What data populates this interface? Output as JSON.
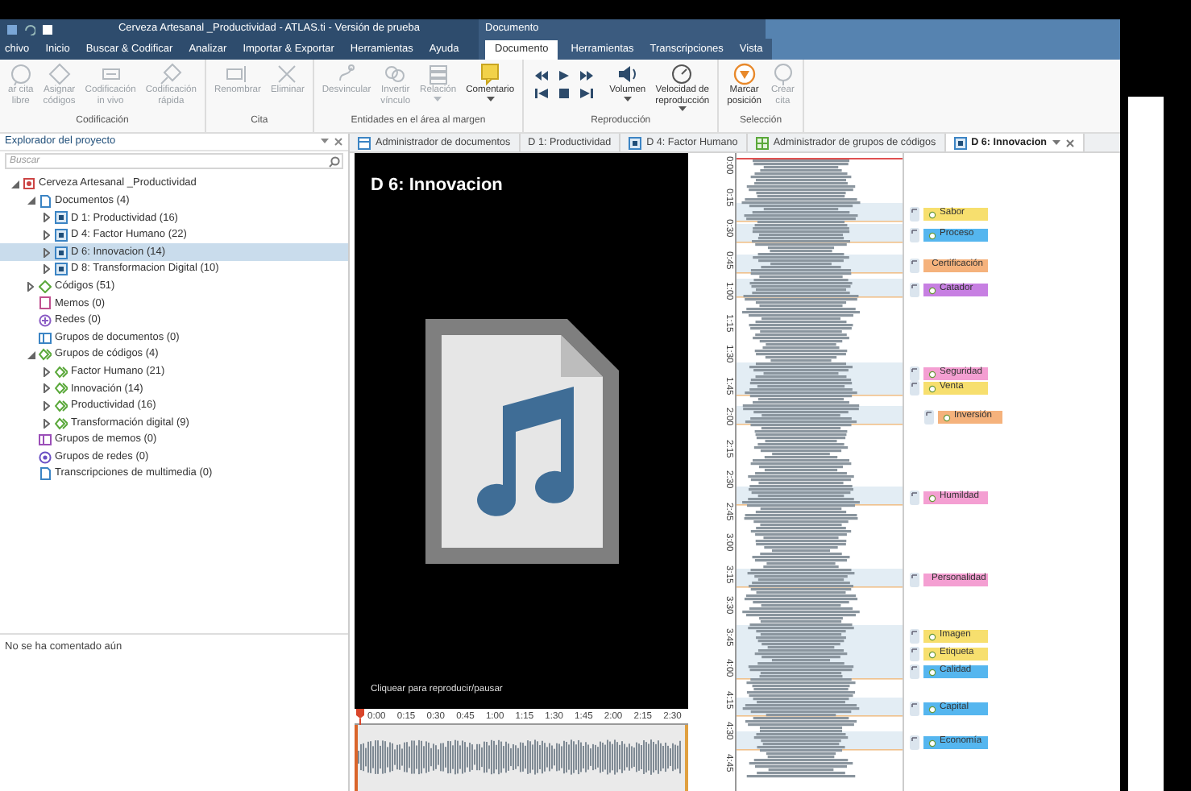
{
  "title_bar": {
    "title": "Cerveza Artesanal _Productividad - ATLAS.ti - Versión de prueba",
    "context_title": "Documento"
  },
  "menu_bar": {
    "tabs": [
      {
        "label": "chivo",
        "selected": false
      },
      {
        "label": "Inicio",
        "selected": false
      },
      {
        "label": "Buscar & Codificar",
        "selected": false
      },
      {
        "label": "Analizar",
        "selected": false
      },
      {
        "label": "Importar & Exportar",
        "selected": false
      },
      {
        "label": "Herramientas",
        "selected": false
      },
      {
        "label": "Ayuda",
        "selected": false
      }
    ],
    "context_tabs": [
      {
        "label": "Documento",
        "selected": true
      },
      {
        "label": "Herramientas",
        "selected": false
      },
      {
        "label": "Transcripciones",
        "selected": false
      },
      {
        "label": "Vista",
        "selected": false
      }
    ]
  },
  "ribbon": [
    {
      "title": "Codificación",
      "buttons": [
        {
          "kind": "large",
          "label": "ar cita\nlibre",
          "disabled": true,
          "dropdown": false
        },
        {
          "kind": "large",
          "label": "Asignar\ncódigos",
          "disabled": true,
          "dropdown": false
        },
        {
          "kind": "large",
          "label": "Codificación\nin vivo",
          "disabled": true,
          "dropdown": false
        },
        {
          "kind": "large",
          "label": "Codificación\nrápida",
          "disabled": true,
          "dropdown": false
        }
      ]
    },
    {
      "title": "Cita",
      "buttons": [
        {
          "kind": "large",
          "label": "Renombrar",
          "disabled": true,
          "dropdown": false
        },
        {
          "kind": "large",
          "label": "Eliminar",
          "disabled": true,
          "dropdown": false
        }
      ]
    },
    {
      "title": "Entidades en el área al margen",
      "buttons": [
        {
          "kind": "large",
          "label": "Desvincular",
          "disabled": true,
          "dropdown": false
        },
        {
          "kind": "large",
          "label": "Invertir\nvínculo",
          "disabled": true,
          "dropdown": false
        },
        {
          "kind": "large",
          "label": "Relación",
          "disabled": true,
          "dropdown": true
        },
        {
          "kind": "large",
          "label": "Comentario",
          "disabled": false,
          "dropdown": true
        }
      ]
    },
    {
      "title": "Reproducción",
      "buttons": [
        {
          "kind": "transport"
        },
        {
          "kind": "large",
          "label": "Volumen",
          "disabled": false,
          "dropdown": true
        },
        {
          "kind": "large",
          "label": "Velocidad de\nreproducción",
          "disabled": false,
          "dropdown": true
        }
      ]
    },
    {
      "title": "Selección",
      "buttons": [
        {
          "kind": "large",
          "label": "Marcar\nposición",
          "disabled": false,
          "dropdown": false
        },
        {
          "kind": "large",
          "label": "Crear\ncita",
          "disabled": true,
          "dropdown": false
        }
      ]
    }
  ],
  "explorer": {
    "title": "Explorador del proyecto",
    "search": {
      "placeholder": "Buscar"
    },
    "tree": [
      {
        "label": "Cerveza Artesanal _Productividad",
        "kind": "project",
        "expanded": true,
        "selected": false,
        "children": [
          {
            "label": "Documentos (4)",
            "kind": "documents",
            "expanded": true,
            "selected": false,
            "children": [
              {
                "label": "D 1: Productividad (16)",
                "kind": "document",
                "expanded": false,
                "selected": false
              },
              {
                "label": "D 4: Factor Humano (22)",
                "kind": "document",
                "expanded": false,
                "selected": false
              },
              {
                "label": "D 6: Innovacion (14)",
                "kind": "document",
                "expanded": false,
                "selected": true
              },
              {
                "label": "D 8: Transformacion Digital (10)",
                "kind": "document",
                "expanded": false,
                "selected": false
              }
            ]
          },
          {
            "label": "Códigos (51)",
            "kind": "codes",
            "expanded": false,
            "selected": false
          },
          {
            "label": "Memos (0)",
            "kind": "memos",
            "selected": false
          },
          {
            "label": "Redes (0)",
            "kind": "networks",
            "selected": false
          },
          {
            "label": "Grupos de documentos (0)",
            "kind": "docgroups",
            "selected": false
          },
          {
            "label": "Grupos de códigos (4)",
            "kind": "codegroups",
            "expanded": true,
            "selected": false,
            "children": [
              {
                "label": "Factor Humano (21)",
                "kind": "codegroup",
                "expanded": false,
                "selected": false
              },
              {
                "label": "Innovación (14)",
                "kind": "codegroup",
                "expanded": false,
                "selected": false
              },
              {
                "label": "Productividad (16)",
                "kind": "codegroup",
                "expanded": false,
                "selected": false
              },
              {
                "label": "Transformación digital (9)",
                "kind": "codegroup",
                "expanded": false,
                "selected": false
              }
            ]
          },
          {
            "label": "Grupos de memos (0)",
            "kind": "memogroups",
            "selected": false
          },
          {
            "label": "Grupos de redes (0)",
            "kind": "netgroups",
            "selected": false
          },
          {
            "label": "Transcripciones de multimedia (0)",
            "kind": "transcripts",
            "selected": false
          }
        ]
      }
    ],
    "comment": "No se ha comentado aún"
  },
  "doc_tabs": [
    {
      "label": "Administrador de documentos",
      "kind": "manager",
      "selected": false
    },
    {
      "label": "D 1: Productividad",
      "kind": "plain",
      "selected": false
    },
    {
      "label": "D 4: Factor Humano",
      "kind": "document",
      "selected": false
    },
    {
      "label": "Administrador de grupos de códigos",
      "kind": "group-manager",
      "selected": false
    },
    {
      "label": "D 6: Innovacion",
      "kind": "document",
      "selected": true
    }
  ],
  "media": {
    "title": "D 6: Innovacion",
    "hint": "Cliquear para reproducir/pausar",
    "timeline": [
      "0:00",
      "0:15",
      "0:30",
      "0:45",
      "1:00",
      "1:15",
      "1:30",
      "1:45",
      "2:00",
      "2:15",
      "2:30"
    ],
    "ruler": [
      "0:00",
      "0:15",
      "0:30",
      "0:45",
      "1:00",
      "1:15",
      "1:30",
      "1:45",
      "2:00",
      "2:15",
      "2:30",
      "2:45",
      "3:00",
      "3:15",
      "3:30",
      "3:45",
      "4:00",
      "4:15",
      "4:30",
      "4:45"
    ]
  },
  "codes": [
    {
      "label": "Sabor",
      "color": "#f7df6e"
    },
    {
      "label": "Proceso",
      "color": "#55b6ef"
    },
    {
      "label": "Certificación",
      "color": "#f5b27c"
    },
    {
      "label": "Catador",
      "color": "#c77fe2"
    },
    {
      "label": "Seguridad",
      "color": "#f49fd2"
    },
    {
      "label": "Venta",
      "color": "#f7df6e"
    },
    {
      "label": "Inversión",
      "color": "#f5b27c"
    },
    {
      "label": "Humildad",
      "color": "#f49fd2"
    },
    {
      "label": "Personalidad",
      "color": "#f49fd2"
    },
    {
      "label": "Imagen",
      "color": "#f7df6e"
    },
    {
      "label": "Etiqueta",
      "color": "#f7df6e"
    },
    {
      "label": "Calidad",
      "color": "#55b6ef"
    },
    {
      "label": "Capital",
      "color": "#55b6ef"
    },
    {
      "label": "Economía",
      "color": "#55b6ef"
    }
  ]
}
